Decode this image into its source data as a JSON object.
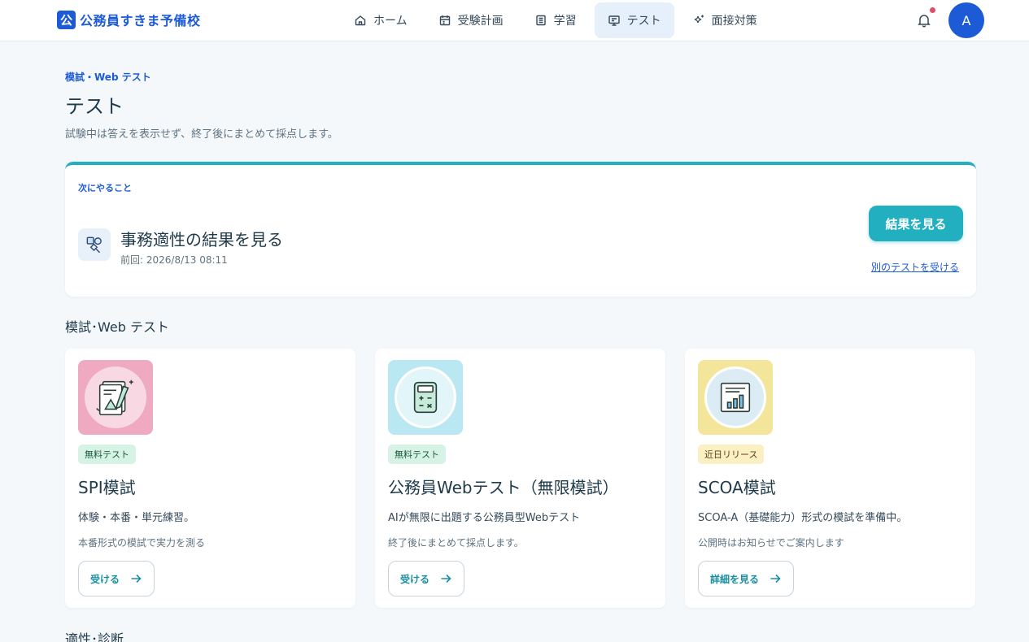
{
  "brand": {
    "mark": "公",
    "name": "公務員すきま予備校",
    "color": "#1d5bd6"
  },
  "nav": [
    {
      "label": "ホーム",
      "icon": "home-icon",
      "active": false
    },
    {
      "label": "受験計画",
      "icon": "calendar-icon",
      "active": false
    },
    {
      "label": "学習",
      "icon": "book-icon",
      "active": false
    },
    {
      "label": "テスト",
      "icon": "monitor-icon",
      "active": true
    },
    {
      "label": "面接対策",
      "icon": "sparkle-icon",
      "active": false
    }
  ],
  "user": {
    "initial": "A",
    "has_notification": true
  },
  "page": {
    "eyebrow": "模試・Web テスト",
    "title": "テスト",
    "description": "試験中は答えを表示せず、終了後にまとめて採点します。"
  },
  "next": {
    "label": "次にやること",
    "title": "事務適性の結果を見る",
    "meta": "前回: 2026/8/13 08:11",
    "primary_label": "結果を見る",
    "secondary_label": "別のテストを受ける",
    "accent": "#22b0c1"
  },
  "section_mock": {
    "title": "模試･Web テスト"
  },
  "section_aptitude": {
    "title": "適性･診断"
  },
  "tests": [
    {
      "badge": "無料テスト",
      "title": "SPI模試",
      "description": "体験・本番・単元練習。",
      "sub": "本番形式の模試で実力を測る",
      "button": "受ける",
      "image_color": "#efa9c0",
      "icon": "document-shapes-icon"
    },
    {
      "badge": "無料テスト",
      "title": "公務員Webテスト（無限模試）",
      "description": "AIが無限に出題する公務員型Webテスト",
      "sub": "終了後にまとめて採点します。",
      "button": "受ける",
      "image_color": "#b9e8f2",
      "icon": "calculator-icon"
    },
    {
      "badge": "近日リリース",
      "title": "SCOA模試",
      "description": "SCOA-A（基礎能力）形式の模試を準備中。",
      "sub": "公開時はお知らせでご案内します",
      "button": "詳細を見る",
      "image_color": "#f3e59a",
      "icon": "bar-chart-icon"
    }
  ]
}
